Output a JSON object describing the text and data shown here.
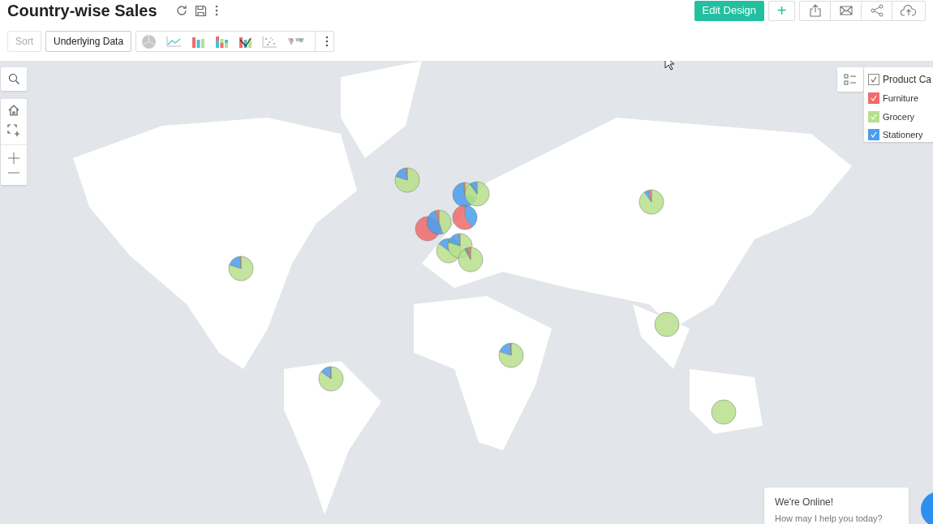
{
  "title": "Country-wise Sales",
  "actions": {
    "primary": "Edit Design",
    "add": "+"
  },
  "toolbar": {
    "sort": {
      "label": "Sort",
      "disabled": true
    },
    "underlying": "Underlying Data"
  },
  "legend": {
    "title": "Product Ca",
    "checked": true,
    "items": [
      {
        "label": "Furniture",
        "checked": true,
        "color": "#f26a6a"
      },
      {
        "label": "Grocery",
        "checked": true,
        "color": "#b8e08c"
      },
      {
        "label": "Stationery",
        "checked": true,
        "color": "#4a9df0"
      }
    ]
  },
  "chat": {
    "title": "We're Online!",
    "subtitle": "How may I help you today?"
  }
}
